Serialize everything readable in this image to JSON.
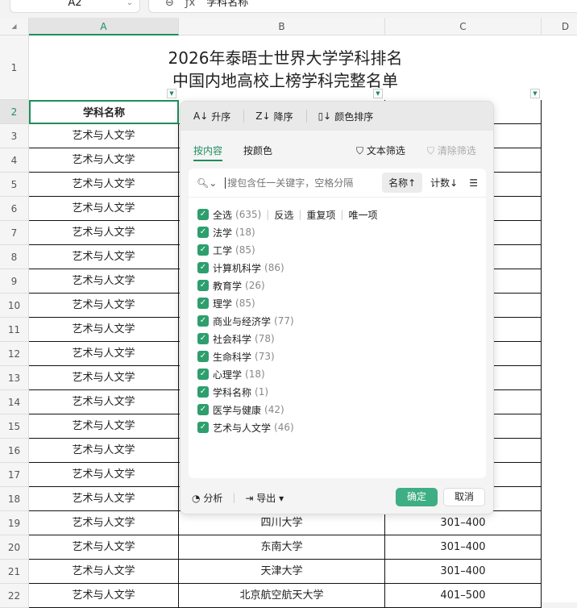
{
  "formula_bar": {
    "cell_ref": "A2",
    "fx": "ƒx",
    "content": "学科名称"
  },
  "columns": [
    "A",
    "B",
    "C",
    "D"
  ],
  "title_line1": "2026年泰晤士世界大学学科排名",
  "title_line2": "中国内地高校上榜学科完整名单",
  "header_cell": "学科名称",
  "rows": [
    {
      "n": "1"
    },
    {
      "n": "2"
    },
    {
      "n": "3",
      "a": "艺术与人文学"
    },
    {
      "n": "4",
      "a": "艺术与人文学"
    },
    {
      "n": "5",
      "a": "艺术与人文学"
    },
    {
      "n": "6",
      "a": "艺术与人文学"
    },
    {
      "n": "7",
      "a": "艺术与人文学"
    },
    {
      "n": "8",
      "a": "艺术与人文学"
    },
    {
      "n": "9",
      "a": "艺术与人文学"
    },
    {
      "n": "10",
      "a": "艺术与人文学"
    },
    {
      "n": "11",
      "a": "艺术与人文学"
    },
    {
      "n": "12",
      "a": "艺术与人文学"
    },
    {
      "n": "13",
      "a": "艺术与人文学"
    },
    {
      "n": "14",
      "a": "艺术与人文学"
    },
    {
      "n": "15",
      "a": "艺术与人文学"
    },
    {
      "n": "16",
      "a": "艺术与人文学"
    },
    {
      "n": "17",
      "a": "艺术与人文学"
    },
    {
      "n": "18",
      "a": "艺术与人文学"
    },
    {
      "n": "19",
      "a": "艺术与人文学",
      "b": "四川大学",
      "c": "301–400"
    },
    {
      "n": "20",
      "a": "艺术与人文学",
      "b": "东南大学",
      "c": "301–400"
    },
    {
      "n": "21",
      "a": "艺术与人文学",
      "b": "天津大学",
      "c": "301–400"
    },
    {
      "n": "22",
      "a": "艺术与人文学",
      "b": "北京航空航天大学",
      "c": "401–500"
    }
  ],
  "filter": {
    "sort_asc": "升序",
    "sort_desc": "降序",
    "sort_color": "颜色排序",
    "tab_content": "按内容",
    "tab_color": "按颜色",
    "text_filter": "文本筛选",
    "clear_filter": "清除筛选",
    "search_placeholder": "搜包含任一关键字，空格分隔",
    "sort_name": "名称↑",
    "sort_count": "计数↓",
    "select_all": "全选",
    "select_all_count": "(635)",
    "invert": "反选",
    "duplicates": "重复项",
    "unique": "唯一项",
    "items": [
      {
        "label": "法学",
        "count": "(18)"
      },
      {
        "label": "工学",
        "count": "(85)"
      },
      {
        "label": "计算机科学",
        "count": "(86)"
      },
      {
        "label": "教育学",
        "count": "(26)"
      },
      {
        "label": "理学",
        "count": "(85)"
      },
      {
        "label": "商业与经济学",
        "count": "(77)"
      },
      {
        "label": "社会科学",
        "count": "(78)"
      },
      {
        "label": "生命科学",
        "count": "(73)"
      },
      {
        "label": "心理学",
        "count": "(18)"
      },
      {
        "label": "学科名称",
        "count": "(1)"
      },
      {
        "label": "医学与健康",
        "count": "(42)"
      },
      {
        "label": "艺术与人文学",
        "count": "(46)"
      }
    ],
    "analyze": "分析",
    "export": "导出",
    "ok": "确定",
    "cancel": "取消"
  },
  "colors": {
    "accent": "#1e8e5e",
    "ok_button": "#3eae84"
  }
}
